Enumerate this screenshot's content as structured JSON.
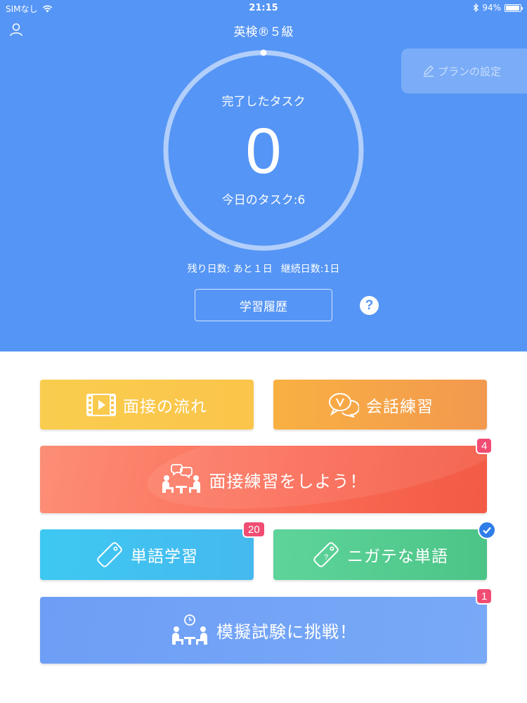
{
  "status_bar": {
    "carrier": "SIMなし",
    "time": "21:15",
    "battery_percent": "94%",
    "battery_level": 0.94
  },
  "header": {
    "title": "英検®５級",
    "plan_button_label": "プランの設定"
  },
  "progress": {
    "completed_label": "完了したタスク",
    "completed_value": "0",
    "today_label": "今日のタスク:6",
    "fraction_completed": 0.0
  },
  "days": {
    "remaining": "残り日数: あと１日",
    "streak": "継続日数:1日"
  },
  "history_button_label": "学習履歴",
  "help_label": "?",
  "menu": {
    "interview_flow": "面接の流れ",
    "conversation_practice": "会話練習",
    "interview_practice": "面接練習をしよう！",
    "interview_practice_badge": "4",
    "vocabulary": "単語学習",
    "vocabulary_badge": "20",
    "weak_words": "ニガテな単語",
    "mock_exam": "模擬試験に挑戦！",
    "mock_exam_badge": "1"
  },
  "colors": {
    "header_bg": "#5595f5",
    "flow": "#f9cd4f",
    "conversation": "#f5a448",
    "interview": "#fb6d58",
    "vocabulary": "#42c1f0",
    "weak_words": "#55cc91",
    "mock_exam": "#72a3f6",
    "badge": "#f14d73",
    "check": "#2f7de9"
  }
}
